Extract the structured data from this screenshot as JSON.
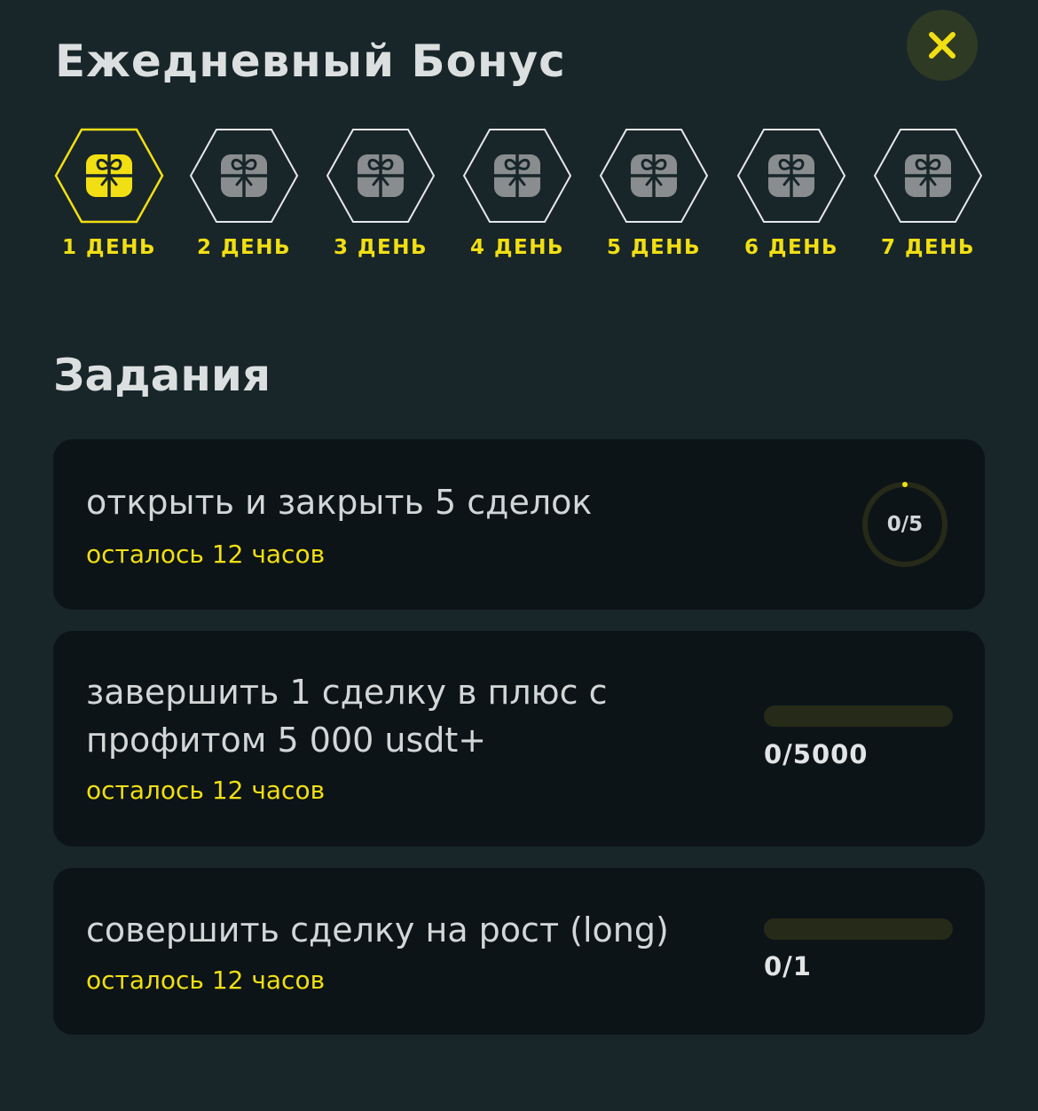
{
  "header": {
    "title": "Ежедневный Бонус",
    "close_icon": "close-icon"
  },
  "colors": {
    "background": "#18262a",
    "card": "#0c1417",
    "accent": "#f2df13",
    "close_bg": "#2f3a25",
    "inactive_gift": "#8a8d8f"
  },
  "days": [
    {
      "label": "1 ДЕНЬ",
      "active": true,
      "icon": "gift-icon"
    },
    {
      "label": "2 ДЕНЬ",
      "active": false,
      "icon": "gift-icon"
    },
    {
      "label": "3 ДЕНЬ",
      "active": false,
      "icon": "gift-icon"
    },
    {
      "label": "4 ДЕНЬ",
      "active": false,
      "icon": "gift-icon"
    },
    {
      "label": "5 ДЕНЬ",
      "active": false,
      "icon": "gift-icon"
    },
    {
      "label": "6 ДЕНЬ",
      "active": false,
      "icon": "gift-icon"
    },
    {
      "label": "7 ДЕНЬ",
      "active": false,
      "icon": "gift-icon"
    }
  ],
  "tasks_section": {
    "title": "Задания"
  },
  "tasks": [
    {
      "title_lines": [
        "открыть и закрыть 5 сделок"
      ],
      "time_left": "осталось 12 часов",
      "progress_text": "0/5",
      "progress_fraction": 0,
      "indicator": "ring"
    },
    {
      "title_lines": [
        "завершить 1 сделку в плюс с",
        "профитом 5 000 usdt+"
      ],
      "time_left": "осталось 12 часов",
      "progress_text": "0/5000",
      "progress_fraction": 0,
      "indicator": "bar"
    },
    {
      "title_lines": [
        "совершить сделку на рост (long)"
      ],
      "time_left": "осталось 12 часов",
      "progress_text": "0/1",
      "progress_fraction": 0,
      "indicator": "bar"
    }
  ]
}
